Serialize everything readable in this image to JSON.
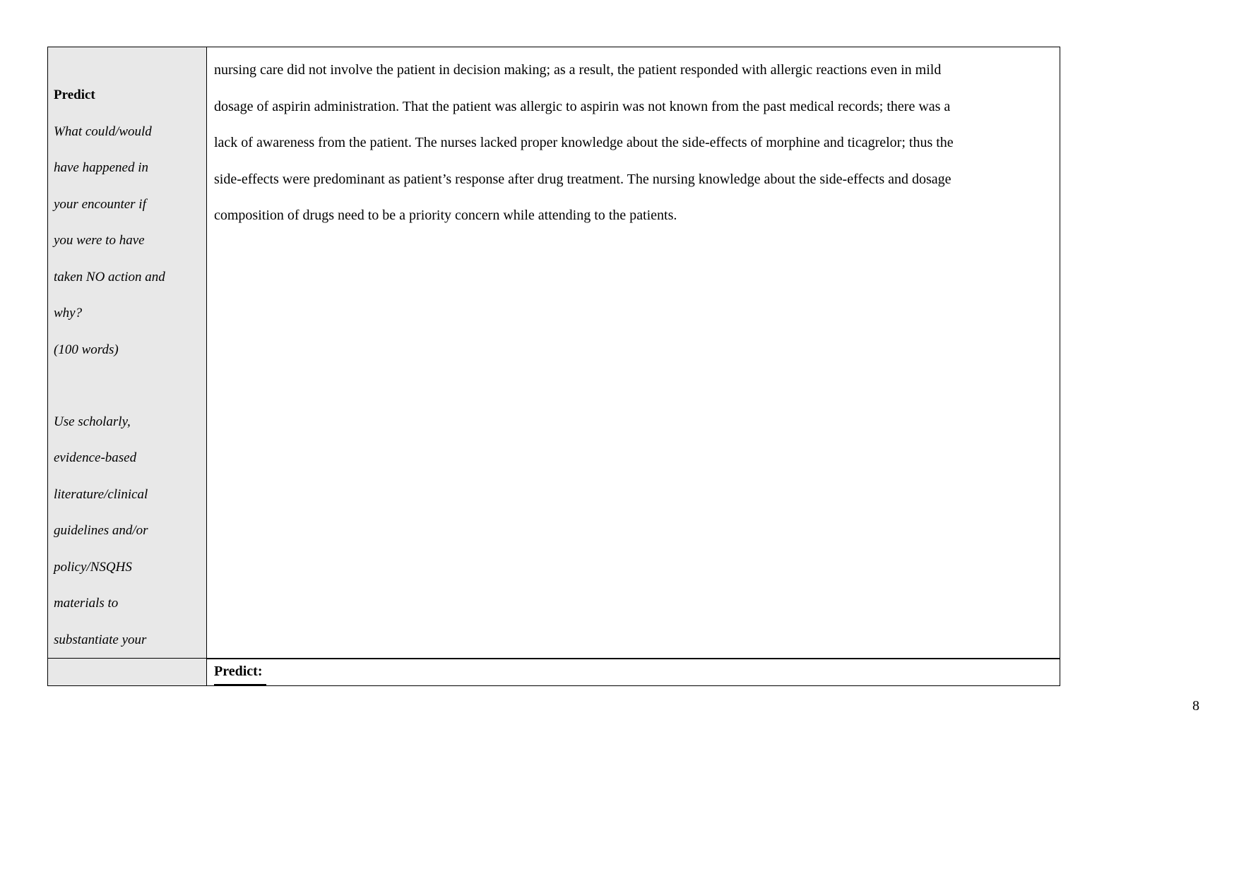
{
  "document": {
    "page_number": "8",
    "background_color": "#ffffff",
    "prompt_cell_fill": "#e8e8e8",
    "border_color": "#000000"
  },
  "table": {
    "prompt_cell": {
      "heading": "Predict",
      "lines": [
        "What could/would",
        "have happened in",
        "your encounter if",
        "you were to have",
        "taken NO action and",
        "why?",
        "(100 words)"
      ],
      "lines_second_block": [
        "Use scholarly,",
        "evidence-based",
        "literature/clinical",
        "guidelines and/or",
        "policy/NSQHS",
        "materials to",
        "substantiate your"
      ]
    },
    "body_cell": {
      "lines": [
        "nursing care did not involve the patient in decision making; as a result, the patient responded with allergic reactions even in mild",
        "dosage of aspirin administration. That the patient was allergic to aspirin was not known from the past medical records; there was a",
        "lack of awareness from the patient. The nurses lacked proper knowledge about the side-effects of morphine and ticagrelor; thus the",
        "side-effects were predominant as patient’s response after drug treatment. The nursing knowledge about the side-effects and dosage",
        "composition of drugs need to be a priority concern while attending to the patients."
      ]
    },
    "footer_row": {
      "label": "Predict: "
    }
  }
}
